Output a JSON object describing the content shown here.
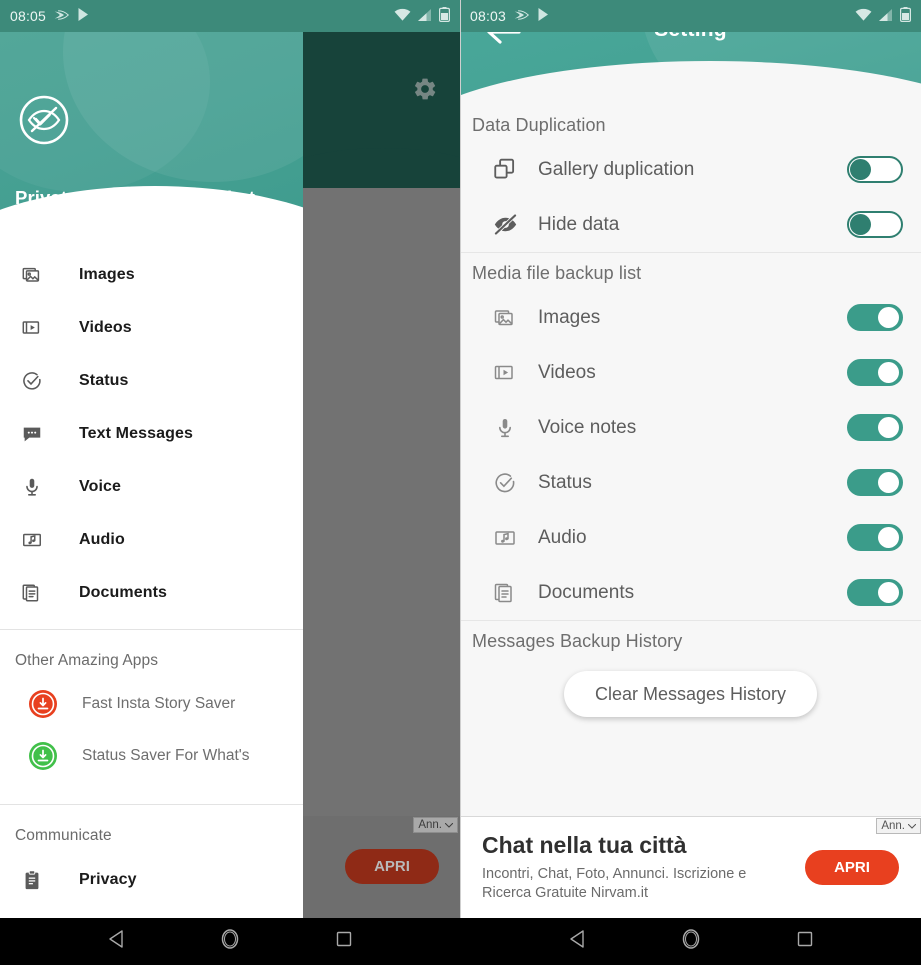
{
  "left_phone": {
    "status_bar": {
      "time": "08:05",
      "left_icons": [
        "cast-icon",
        "play-store-icon"
      ],
      "right_icons": [
        "wifi-icon",
        "signal-icon",
        "battery-icon"
      ]
    },
    "drawer": {
      "app_title": "Private Read - Hidden Chat",
      "logo_icon": "hidden-eye-logo-icon",
      "menu_items": [
        {
          "label": "Images",
          "icon": "images-icon"
        },
        {
          "label": "Videos",
          "icon": "videos-icon"
        },
        {
          "label": "Status",
          "icon": "status-check-icon"
        },
        {
          "label": "Text Messages",
          "icon": "chat-bubble-icon"
        },
        {
          "label": "Voice",
          "icon": "microphone-icon"
        },
        {
          "label": "Audio",
          "icon": "audio-note-icon"
        },
        {
          "label": "Documents",
          "icon": "documents-icon"
        }
      ],
      "other_apps_title": "Other Amazing Apps",
      "other_apps": [
        {
          "label": "Fast Insta Story Saver",
          "icon": "download-circle-icon",
          "color": "#e8401f"
        },
        {
          "label": "Status Saver For What's",
          "icon": "download-circle-icon",
          "color": "#41c04a"
        }
      ],
      "communicate_title": "Communicate",
      "communicate_items": [
        {
          "label": "Privacy",
          "icon": "clipboard-icon"
        }
      ]
    },
    "behind_app": {
      "gear_icon": "gear-icon"
    }
  },
  "right_phone": {
    "status_bar": {
      "time": "08:03",
      "left_icons": [
        "cast-icon",
        "play-store-icon"
      ],
      "right_icons": [
        "wifi-icon",
        "signal-icon",
        "battery-icon"
      ]
    },
    "header": {
      "title": "Setting",
      "back_icon": "back-arrow-icon"
    },
    "sections": [
      {
        "title": "Data Duplication",
        "rows": [
          {
            "label": "Gallery duplication",
            "icon": "copy-icon",
            "toggle": "off"
          },
          {
            "label": "Hide data",
            "icon": "eye-slash-icon",
            "toggle": "off"
          }
        ]
      },
      {
        "title": "Media file backup list",
        "rows": [
          {
            "label": "Images",
            "icon": "images-icon",
            "toggle": "on"
          },
          {
            "label": "Videos",
            "icon": "videos-icon",
            "toggle": "on"
          },
          {
            "label": "Voice notes",
            "icon": "microphone-icon",
            "toggle": "on"
          },
          {
            "label": "Status",
            "icon": "status-check-icon",
            "toggle": "on"
          },
          {
            "label": "Audio",
            "icon": "audio-note-icon",
            "toggle": "on"
          },
          {
            "label": "Documents",
            "icon": "documents-icon",
            "toggle": "on"
          }
        ]
      },
      {
        "title": "Messages Backup History",
        "rows": [],
        "button": "Clear Messages History"
      }
    ]
  },
  "ad": {
    "label": "Ann.",
    "title": "Chat nella tua città",
    "subtitle": "Incontri, Chat, Foto, Annunci. Iscrizione e Ricerca Gratuite Nirvam.it",
    "cta": "APRI",
    "cta_color": "#e8401f"
  },
  "nav_bar": {
    "buttons": [
      "back-triangle-icon",
      "home-circle-icon",
      "recents-square-icon"
    ]
  },
  "colors": {
    "status_bar": "#3d8a7a",
    "header_teal": "#46a093",
    "toggle_on": "#3b9c8a",
    "toggle_off_border": "#2f7f70",
    "accent_red": "#e8401f",
    "behind_header_dark": "#17433a"
  }
}
